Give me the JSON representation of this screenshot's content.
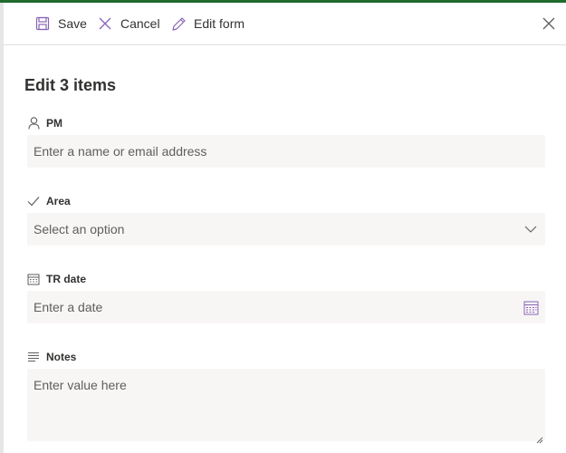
{
  "toolbar": {
    "save_label": "Save",
    "cancel_label": "Cancel",
    "edit_form_label": "Edit form"
  },
  "panel": {
    "title": "Edit 3 items"
  },
  "fields": {
    "pm": {
      "label": "PM",
      "placeholder": "Enter a name or email address",
      "icon": "person-icon"
    },
    "area": {
      "label": "Area",
      "placeholder": "Select an option",
      "icon": "checkmark-icon"
    },
    "tr_date": {
      "label": "TR date",
      "placeholder": "Enter a date",
      "icon": "calendar-icon"
    },
    "notes": {
      "label": "Notes",
      "placeholder": "Enter value here",
      "icon": "text-lines-icon"
    }
  },
  "colors": {
    "accent": "#8764b8",
    "top_bar": "#1e6b2c",
    "field_bg": "#f8f6f5"
  }
}
